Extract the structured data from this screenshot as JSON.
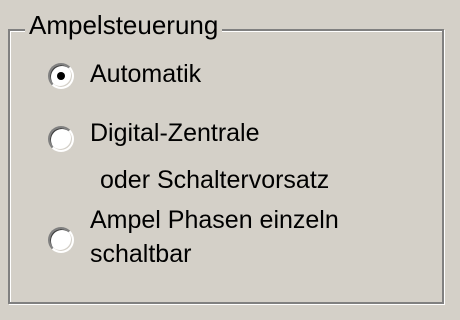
{
  "group": {
    "title": "Ampelsteuerung",
    "options": [
      {
        "line1": "Automatik",
        "line2": "",
        "selected": true
      },
      {
        "line1": "Digital-Zentrale",
        "line2": " oder Schaltervorsatz",
        "selected": false
      },
      {
        "line1": "Ampel Phasen einzeln",
        "line2": "schaltbar",
        "selected": false
      }
    ]
  }
}
